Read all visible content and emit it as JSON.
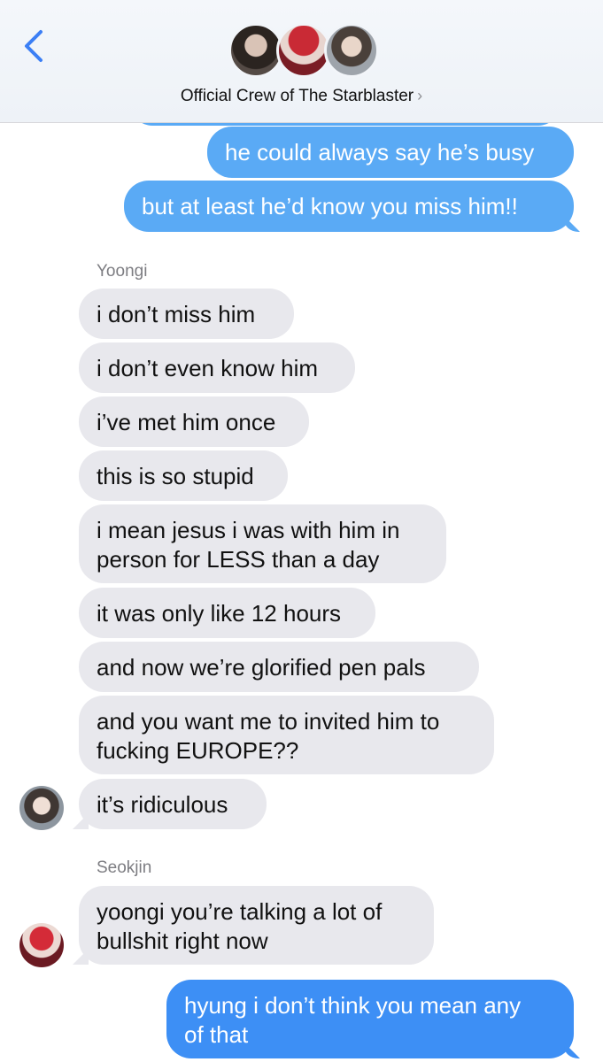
{
  "header": {
    "back_icon": "chevron-left-icon",
    "title": "Official Crew of The Starblaster",
    "title_chevron": "›",
    "accent_color": "#3b7ff5"
  },
  "messages": {
    "m1": "he could always say he’s busy",
    "m2": "but at least he’d know you miss him!!",
    "sender_yoongi": "Yoongi",
    "y1": "i don’t miss him",
    "y2": "i don’t even know him",
    "y3": "i’ve met him once",
    "y4": "this is so stupid",
    "y5": "i mean jesus i was with him in\nperson for LESS than a day",
    "y6": "it was only like 12 hours",
    "y7": "and now we’re glorified pen pals",
    "y8": "and you want me to invited him to\nfucking EUROPE??",
    "y9": "it’s ridiculous",
    "sender_seokjin": "Seokjin",
    "s1": "yoongi you’re talking a lot of\nbullshit right now",
    "m3": "hyung i don’t think you mean any\nof that"
  },
  "colors": {
    "outgoing_light": "#5aaaf5",
    "outgoing_dark": "#3d8ff5",
    "incoming": "#e8e8ed"
  }
}
